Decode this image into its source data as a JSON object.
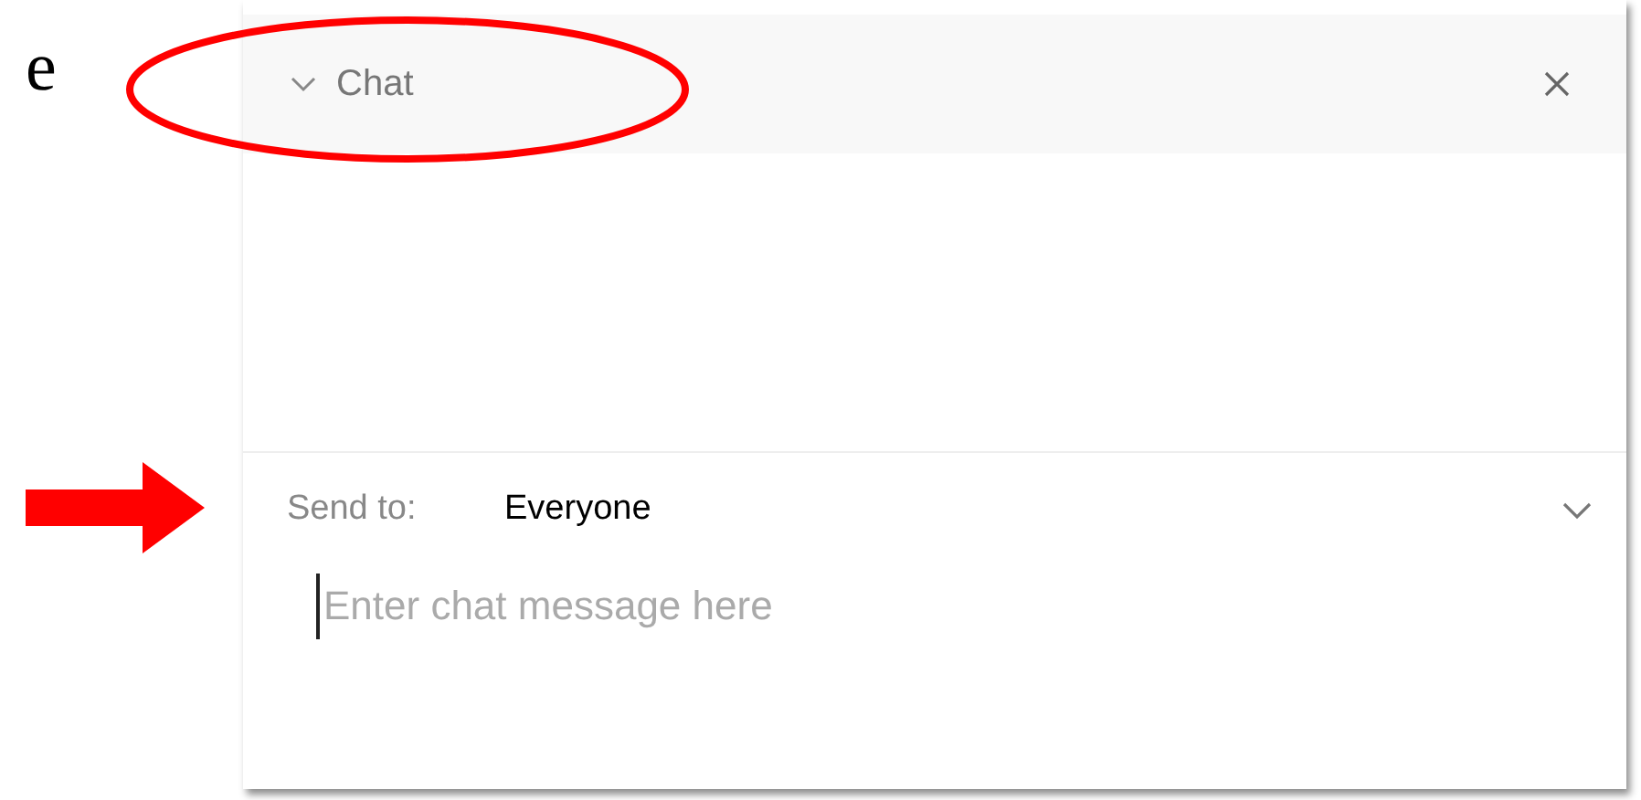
{
  "document_text": "e",
  "panel": {
    "title": "Chat",
    "expanded": true,
    "send_to": {
      "label": "Send to:",
      "value": "Everyone"
    },
    "message": {
      "placeholder": "Enter chat message here"
    }
  }
}
